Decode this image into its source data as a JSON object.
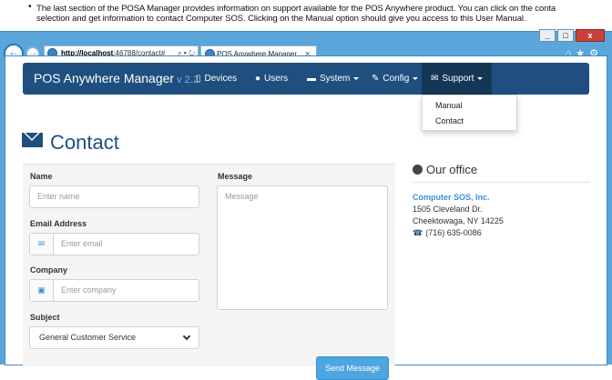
{
  "instructions": {
    "line1": "The last section of the POSA Manager provides information on support available for the POS Anywhere product. You can click on the conta",
    "line2": "selection and get information to contact Computer SOS. Clicking on the Manual option should give you access to this User Manual."
  },
  "browser": {
    "url_host": "http://localhost",
    "url_rest": ":46788/contact#",
    "tab_title": "POS Anywhere Manager",
    "window_controls": [
      "_",
      "□",
      "x"
    ]
  },
  "navbar": {
    "brand": "POS Anywhere Manager",
    "version": "v 2.2",
    "items": [
      {
        "label": "Devices",
        "icon": "tablet-icon"
      },
      {
        "label": "Users",
        "icon": "user-icon"
      },
      {
        "label": "System",
        "icon": "hdd-icon"
      },
      {
        "label": "Config",
        "icon": "wrench-icon"
      },
      {
        "label": "Support",
        "icon": "envelope-icon"
      }
    ]
  },
  "support_menu": [
    "Manual",
    "Contact"
  ],
  "page": {
    "title": "Contact"
  },
  "form": {
    "name_label": "Name",
    "name_placeholder": "Enter name",
    "email_label": "Email Address",
    "email_placeholder": "Enter email",
    "company_label": "Company",
    "company_placeholder": "Enter company",
    "subject_label": "Subject",
    "subject_value": "General Customer Service",
    "message_label": "Message",
    "message_placeholder": "Message",
    "send_label": "Send Message"
  },
  "office": {
    "heading": "Our office",
    "company": "Computer SOS, Inc.",
    "street": "1505 Cleveland Dr.",
    "city": "Cheektowaga, NY 14225",
    "phone": "(716) 635-0086"
  },
  "colors": {
    "navbar": "#1f4f7f",
    "accent": "#3f8fd3",
    "button": "#4ea6e1",
    "browser_frame": "#5aa6da"
  }
}
